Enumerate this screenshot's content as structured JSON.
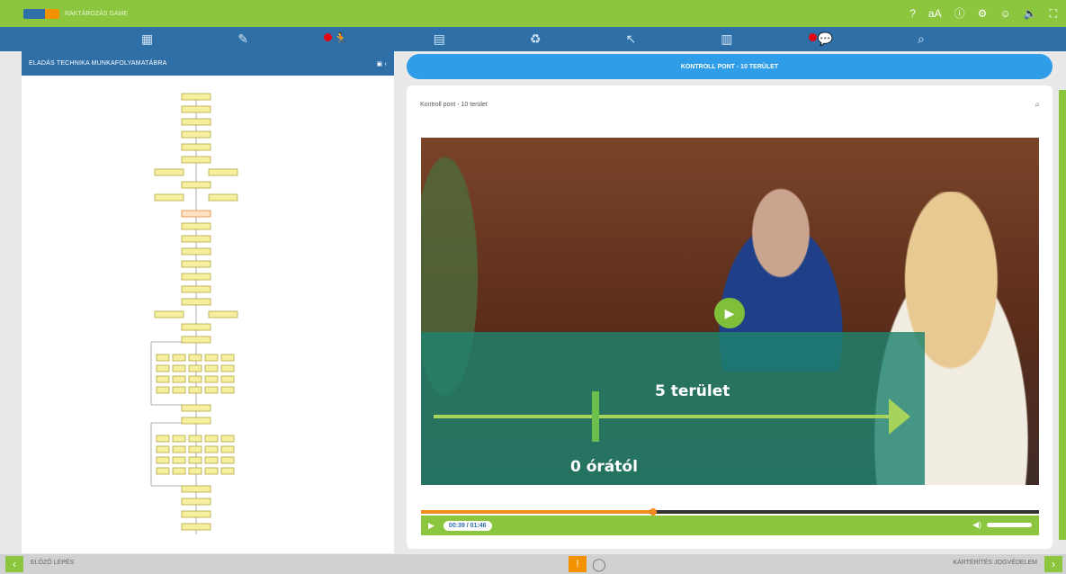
{
  "app": {
    "logo_text": "RAKTÁROZÁS GAME"
  },
  "top_icons": [
    "help-icon",
    "font-size-icon",
    "info-icon",
    "settings-icon",
    "user-icon",
    "sound-icon",
    "fullscreen-icon"
  ],
  "nav_icons": [
    {
      "name": "map-icon",
      "badge": false
    },
    {
      "name": "edit-icon",
      "badge": false
    },
    {
      "name": "runner-icon",
      "badge": true
    },
    {
      "name": "document-icon",
      "badge": false
    },
    {
      "name": "recycle-icon",
      "badge": false
    },
    {
      "name": "cursor-icon",
      "badge": false
    },
    {
      "name": "chart-icon",
      "badge": false
    },
    {
      "name": "chat-icon",
      "badge": true
    },
    {
      "name": "search-icon",
      "badge": false
    }
  ],
  "left_panel": {
    "title": "ELADÁS TECHNIKA MUNKAFOLYAMATÁBRA"
  },
  "main": {
    "header": "KONTROLL PONT - 10 TERÜLET",
    "subtitle": "Kontroll pont - 10 terület",
    "overlay_top": "5 terület",
    "overlay_bottom": "0 órától",
    "time": "00:39 / 01:46",
    "progress_fraction": 0.37
  },
  "footer": {
    "prev_label": "ELŐZŐ LÉPÉS",
    "next_label": "KÁRTÉRÍTÉS JOGVÉDELEM"
  },
  "colors": {
    "green": "#8cc63f",
    "blue": "#2f6fa7",
    "header_blue": "#2f9de8",
    "orange": "#f39200"
  }
}
